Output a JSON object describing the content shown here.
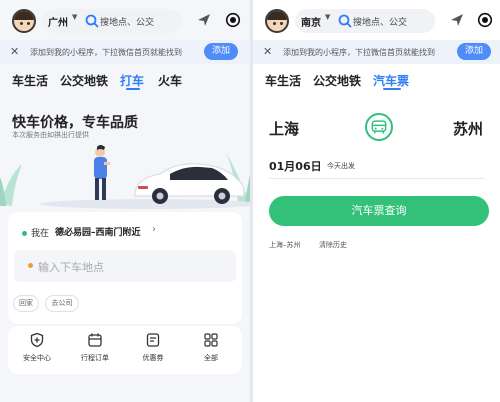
{
  "left": {
    "city": "广州",
    "search_placeholder": "搜地点、公交",
    "banner_text": "添加到我的小程序，下拉微信首页就能找到",
    "banner_button": "添加",
    "tabs": [
      {
        "label": "车生活"
      },
      {
        "label": "公交地铁"
      },
      {
        "label": "打车",
        "active": true
      },
      {
        "label": "火车"
      }
    ],
    "hero_title": "快车价格，专车品质",
    "hero_subtitle": "本次服务由如祺出行提供",
    "current_location_prefix": "我在",
    "current_location": "德必易园–西南门附近",
    "destination_placeholder": "输入下车地点",
    "chips": [
      "回家",
      "去公司"
    ],
    "shortcuts": [
      {
        "label": "安全中心",
        "icon": "shield-plus-icon"
      },
      {
        "label": "行程订单",
        "icon": "calendar-icon"
      },
      {
        "label": "优惠券",
        "icon": "coupon-icon"
      },
      {
        "label": "全部",
        "icon": "grid-icon"
      }
    ]
  },
  "right": {
    "city": "南京",
    "search_placeholder": "搜地点、公交",
    "banner_text": "添加到我的小程序，下拉微信首页就能找到",
    "banner_button": "添加",
    "tabs": [
      {
        "label": "车生活"
      },
      {
        "label": "公交地铁"
      },
      {
        "label": "汽车票",
        "active": true
      }
    ],
    "from_city": "上海",
    "to_city": "苏州",
    "date": "01月06日",
    "date_note": "今天出发",
    "query_button": "汽车票查询",
    "history_route": "上海–苏州",
    "clear_history": "清除历史"
  },
  "colors": {
    "accent_blue": "#2f7df6",
    "accent_green": "#33c17a",
    "banner_bg": "#eef3fb"
  }
}
